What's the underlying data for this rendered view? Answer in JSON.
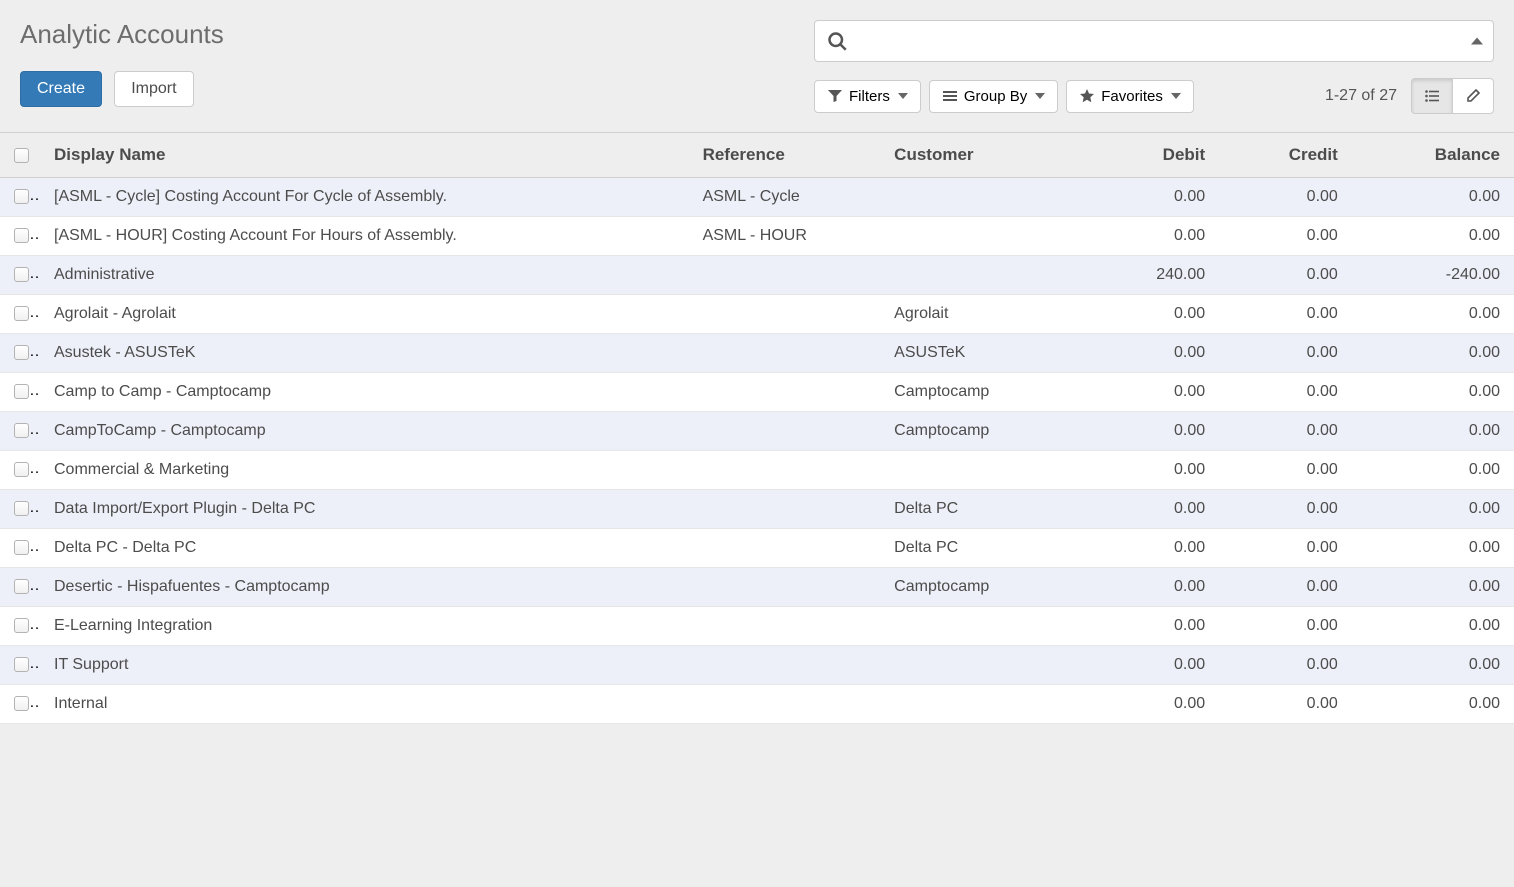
{
  "page_title": "Analytic Accounts",
  "buttons": {
    "create": "Create",
    "import": "Import"
  },
  "search": {
    "placeholder": "",
    "filters_label": "Filters",
    "groupby_label": "Group By",
    "favorites_label": "Favorites"
  },
  "pager": {
    "text": "1-27 of 27"
  },
  "columns": {
    "display_name": "Display Name",
    "reference": "Reference",
    "customer": "Customer",
    "debit": "Debit",
    "credit": "Credit",
    "balance": "Balance"
  },
  "rows": [
    {
      "display_name": "[ASML - Cycle] Costing Account For Cycle of Assembly.",
      "reference": "ASML - Cycle",
      "customer": "",
      "debit": "0.00",
      "credit": "0.00",
      "balance": "0.00"
    },
    {
      "display_name": "[ASML - HOUR] Costing Account For Hours of Assembly.",
      "reference": "ASML - HOUR",
      "customer": "",
      "debit": "0.00",
      "credit": "0.00",
      "balance": "0.00"
    },
    {
      "display_name": "Administrative",
      "reference": "",
      "customer": "",
      "debit": "240.00",
      "credit": "0.00",
      "balance": "-240.00"
    },
    {
      "display_name": "Agrolait - Agrolait",
      "reference": "",
      "customer": "Agrolait",
      "debit": "0.00",
      "credit": "0.00",
      "balance": "0.00"
    },
    {
      "display_name": "Asustek - ASUSTeK",
      "reference": "",
      "customer": "ASUSTeK",
      "debit": "0.00",
      "credit": "0.00",
      "balance": "0.00"
    },
    {
      "display_name": "Camp to Camp - Camptocamp",
      "reference": "",
      "customer": "Camptocamp",
      "debit": "0.00",
      "credit": "0.00",
      "balance": "0.00"
    },
    {
      "display_name": "CampToCamp - Camptocamp",
      "reference": "",
      "customer": "Camptocamp",
      "debit": "0.00",
      "credit": "0.00",
      "balance": "0.00"
    },
    {
      "display_name": "Commercial & Marketing",
      "reference": "",
      "customer": "",
      "debit": "0.00",
      "credit": "0.00",
      "balance": "0.00"
    },
    {
      "display_name": "Data Import/Export Plugin - Delta PC",
      "reference": "",
      "customer": "Delta PC",
      "debit": "0.00",
      "credit": "0.00",
      "balance": "0.00"
    },
    {
      "display_name": "Delta PC - Delta PC",
      "reference": "",
      "customer": "Delta PC",
      "debit": "0.00",
      "credit": "0.00",
      "balance": "0.00"
    },
    {
      "display_name": "Desertic - Hispafuentes - Camptocamp",
      "reference": "",
      "customer": "Camptocamp",
      "debit": "0.00",
      "credit": "0.00",
      "balance": "0.00"
    },
    {
      "display_name": "E-Learning Integration",
      "reference": "",
      "customer": "",
      "debit": "0.00",
      "credit": "0.00",
      "balance": "0.00"
    },
    {
      "display_name": "IT Support",
      "reference": "",
      "customer": "",
      "debit": "0.00",
      "credit": "0.00",
      "balance": "0.00"
    },
    {
      "display_name": "Internal",
      "reference": "",
      "customer": "",
      "debit": "0.00",
      "credit": "0.00",
      "balance": "0.00"
    }
  ]
}
